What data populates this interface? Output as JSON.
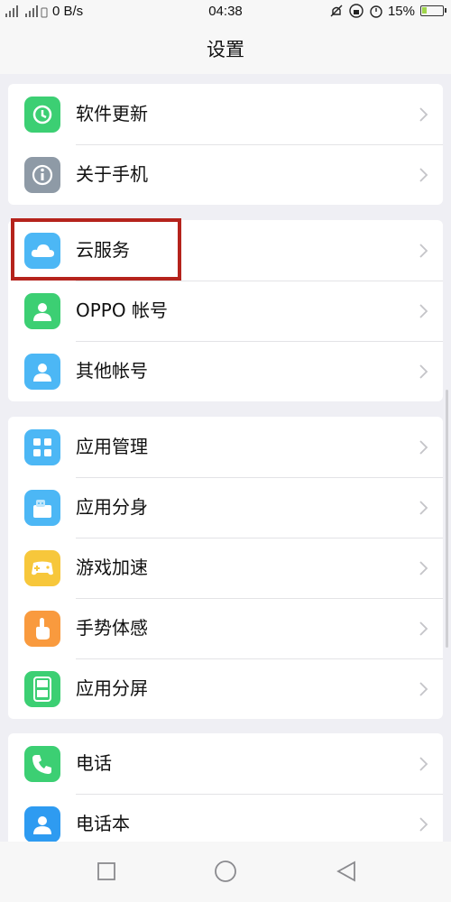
{
  "status": {
    "net_speed": "0 B/s",
    "time": "04:38",
    "battery": "15%"
  },
  "header": {
    "title": "设置"
  },
  "groups": [
    {
      "items": [
        {
          "label": "软件更新",
          "icon": "software-update-icon",
          "color": "#3ccf73"
        },
        {
          "label": "关于手机",
          "icon": "info-icon",
          "color": "#8e9aa6"
        }
      ]
    },
    {
      "items": [
        {
          "label": "云服务",
          "icon": "cloud-icon",
          "color": "#4cb7f5"
        },
        {
          "label": "OPPO 帐号",
          "icon": "oppo-account-icon",
          "color": "#3ccf73"
        },
        {
          "label": "其他帐号",
          "icon": "other-accounts-icon",
          "color": "#4cb7f5"
        }
      ]
    },
    {
      "items": [
        {
          "label": "应用管理",
          "icon": "app-management-icon",
          "color": "#4cb7f5"
        },
        {
          "label": "应用分身",
          "icon": "app-clone-icon",
          "color": "#4cb7f5"
        },
        {
          "label": "游戏加速",
          "icon": "game-boost-icon",
          "color": "#f7c73b"
        },
        {
          "label": "手势体感",
          "icon": "gesture-icon",
          "color": "#f99a3e"
        },
        {
          "label": "应用分屏",
          "icon": "split-screen-icon",
          "color": "#3ccf73"
        }
      ]
    },
    {
      "items": [
        {
          "label": "电话",
          "icon": "phone-icon",
          "color": "#3ccf73"
        },
        {
          "label": "电话本",
          "icon": "contacts-icon",
          "color": "#2e9bf1"
        }
      ]
    }
  ]
}
